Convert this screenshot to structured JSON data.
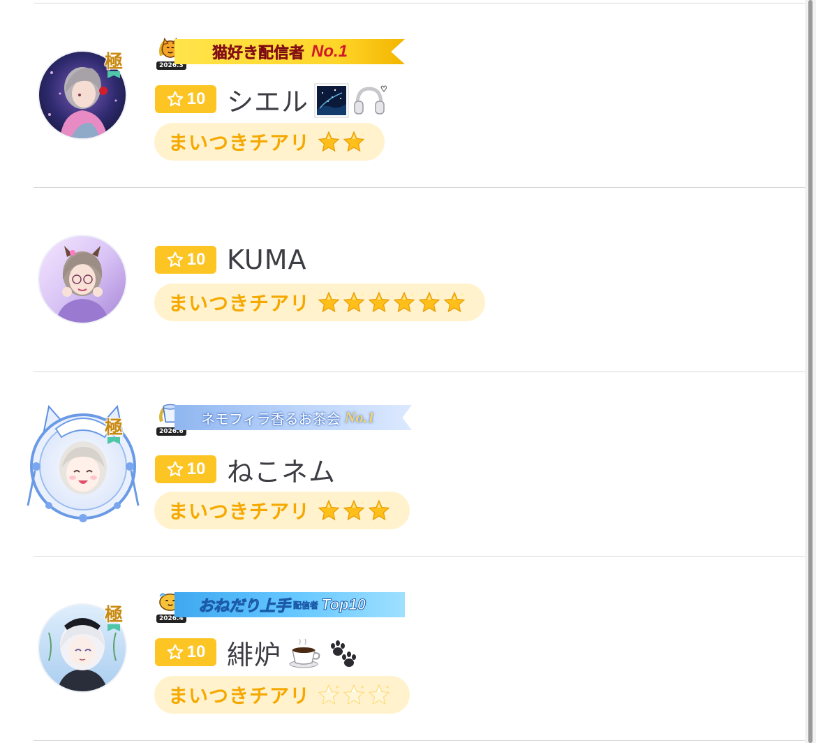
{
  "colors": {
    "level_badge": "#fdc524",
    "cheer_pill_bg": "#fff2cc",
    "cheer_label": "#f5a800",
    "username": "#3c3c43",
    "divider": "#d8d8d8"
  },
  "rows": [
    {
      "username": "シエル",
      "level": "10",
      "kiwami_label": "極",
      "banner": {
        "title": "猫好き配信者",
        "rank": "No.1",
        "year": "2026.3",
        "style": "gold"
      },
      "name_icons": [
        "night-sky-icon",
        "headphones-icon"
      ],
      "cheer": {
        "label": "まいつきチアリ",
        "stars": 2,
        "star_style": "gold"
      }
    },
    {
      "username": "KUMA",
      "level": "10",
      "banner": null,
      "name_icons": [],
      "cheer": {
        "label": "まいつきチアリ",
        "stars": 6,
        "star_style": "gold"
      }
    },
    {
      "username": "ねこネム",
      "level": "10",
      "kiwami_label": "極",
      "banner": {
        "title": "ネモフィラ香るお茶会",
        "rank": "No.1",
        "year": "2026.6",
        "style": "blue"
      },
      "name_icons": [],
      "cheer": {
        "label": "まいつきチアリ",
        "stars": 3,
        "star_style": "gold"
      }
    },
    {
      "username": "緋炉",
      "level": "10",
      "kiwami_label": "極",
      "banner": {
        "title": "おねだり上手",
        "subtitle": "配信者",
        "rank": "Top10",
        "year": "2026.4",
        "style": "cyan"
      },
      "name_icons": [
        "coffee-icon",
        "paw-prints-icon"
      ],
      "cheer": {
        "label": "まいつきチアリ",
        "stars": 3,
        "star_style": "sparkle"
      }
    }
  ]
}
